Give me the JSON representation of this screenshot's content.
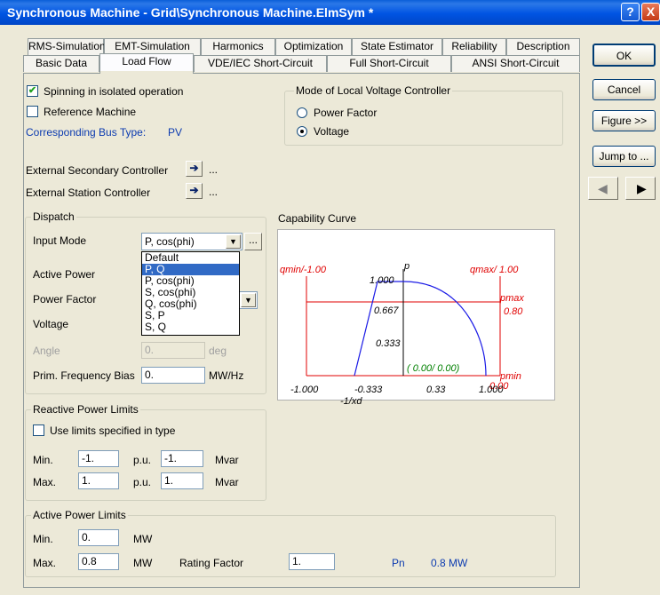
{
  "window": {
    "title": "Synchronous Machine - Grid\\Synchronous Machine.ElmSym *",
    "help_glyph": "?",
    "close_glyph": "X"
  },
  "tabs_row1": [
    "RMS-Simulation",
    "EMT-Simulation",
    "Harmonics",
    "Optimization",
    "State Estimator",
    "Reliability",
    "Description"
  ],
  "tabs_row2": [
    "Basic Data",
    "Load Flow",
    "VDE/IEC Short-Circuit",
    "Full Short-Circuit",
    "ANSI Short-Circuit"
  ],
  "active_tab": "Load Flow",
  "general": {
    "spinning_label": "Spinning in isolated operation",
    "spinning_checked": true,
    "reference_label": "Reference Machine",
    "reference_checked": false,
    "bus_type_label": "Corresponding Bus Type:",
    "bus_type_value": "PV",
    "check_glyph": "✔"
  },
  "voltage_controller": {
    "title": "Mode of Local Voltage Controller",
    "options": [
      "Power Factor",
      "Voltage"
    ],
    "selected": "Voltage"
  },
  "controllers": {
    "secondary_label": "External Secondary Controller",
    "station_label": "External Station Controller",
    "arrow_glyph": "➔",
    "ellipsis": "..."
  },
  "dispatch": {
    "title": "Dispatch",
    "input_mode_label": "Input Mode",
    "input_mode_value": "P, cos(phi)",
    "more_btn": "...",
    "dropdown_options": [
      "Default",
      "P, Q",
      "P, cos(phi)",
      "S, cos(phi)",
      "Q, cos(phi)",
      "S, P",
      "S, Q"
    ],
    "dropdown_selected": "P, Q",
    "active_power_label": "Active Power",
    "power_factor_label": "Power Factor",
    "voltage_label": "Voltage",
    "angle_label": "Angle",
    "angle_value": "0.",
    "angle_unit": "deg",
    "freq_bias_label": "Prim. Frequency Bias",
    "freq_bias_value": "0.",
    "freq_bias_unit": "MW/Hz",
    "chevron": "▼"
  },
  "capability_curve": {
    "title": "Capability Curve",
    "qmin_label": "qmin/-1.00",
    "qmax_label": "qmax/ 1.00",
    "p_axis": "p",
    "pmax_label": "pmax",
    "pmax_value": "0.80",
    "pmin_label": "pmin",
    "pmin_value": "0.00",
    "y_ticks": [
      "1.000",
      "0.667",
      "0.333"
    ],
    "x_ticks": [
      "-1.000",
      "-0.333",
      "0.33",
      "1.000"
    ],
    "x_label": "-1/xd",
    "operating_point": "( 0.00/ 0.00)",
    "colors": {
      "limits": "#e00000",
      "curve": "#1a1ae6",
      "point": "#008000"
    }
  },
  "reactive_limits": {
    "title": "Reactive Power Limits",
    "use_type_label": "Use limits specified in type",
    "use_type_checked": false,
    "min_label": "Min.",
    "min_pu": "-1.",
    "min_mvar": "-1.",
    "max_label": "Max.",
    "max_pu": "1.",
    "max_mvar": "1.",
    "pu_unit": "p.u.",
    "mvar_unit": "Mvar"
  },
  "active_limits": {
    "title": "Active Power Limits",
    "min_label": "Min.",
    "min_value": "0.",
    "max_label": "Max.",
    "max_value": "0.8",
    "unit": "MW",
    "rating_factor_label": "Rating Factor",
    "rating_factor_value": "1.",
    "pn_label": "Pn",
    "pn_value": "0.8 MW"
  },
  "side_buttons": {
    "ok": "OK",
    "cancel": "Cancel",
    "figure": "Figure >>",
    "jump": "Jump to ...",
    "prev_glyph": "◀",
    "next_glyph": "▶"
  }
}
